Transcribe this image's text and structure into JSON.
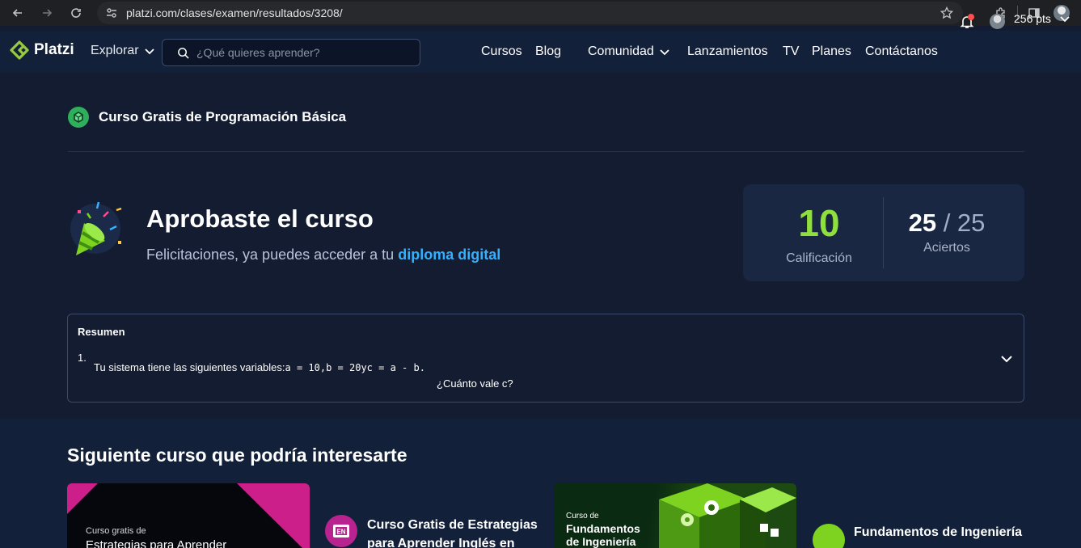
{
  "browser": {
    "url": "platzi.com/clases/examen/resultados/3208/"
  },
  "header": {
    "logo_text": "Platzi",
    "explorar_label": "Explorar",
    "search_placeholder": "¿Qué quieres aprender?",
    "nav": {
      "cursos": "Cursos",
      "blog": "Blog",
      "comunidad": "Comunidad",
      "lanzamientos": "Lanzamientos",
      "tv": "TV",
      "planes": "Planes",
      "contactanos": "Contáctanos"
    },
    "points": "256 pts"
  },
  "course": {
    "name": "Curso Gratis de Programación Básica"
  },
  "result": {
    "title": "Aprobaste el curso",
    "subtitle_prefix": "Felicitaciones, ya puedes acceder a tu",
    "subtitle_link": "diploma digital",
    "calificacion_value": "10",
    "calificacion_label": "Calificación",
    "aciertos_got": "25",
    "aciertos_total": "/ 25",
    "aciertos_label": "Aciertos"
  },
  "resumen": {
    "title": "Resumen",
    "q_number": "1.",
    "q_text": "Tu sistema tiene las siguientes variables:",
    "q_code": "a = 10,b = 20yc = a - b.",
    "q_line2": "¿Cuánto vale c?"
  },
  "next": {
    "title": "Siguiente curso que podría interesarte",
    "card1": {
      "thumb_small": "Curso gratis de",
      "thumb_big": "Estrategias para Aprender",
      "icon_text": "EN",
      "title": "Curso Gratis de Estrategias para Aprender Inglés en"
    },
    "card2": {
      "thumb_small": "Curso de",
      "thumb_big_1": "Fundamentos",
      "thumb_big_2": "de Ingeniería",
      "title": "Fundamentos de Ingeniería"
    }
  },
  "colors": {
    "accent_green": "#8fe03c",
    "link_blue": "#33b1ff",
    "bg": "#131c31"
  }
}
